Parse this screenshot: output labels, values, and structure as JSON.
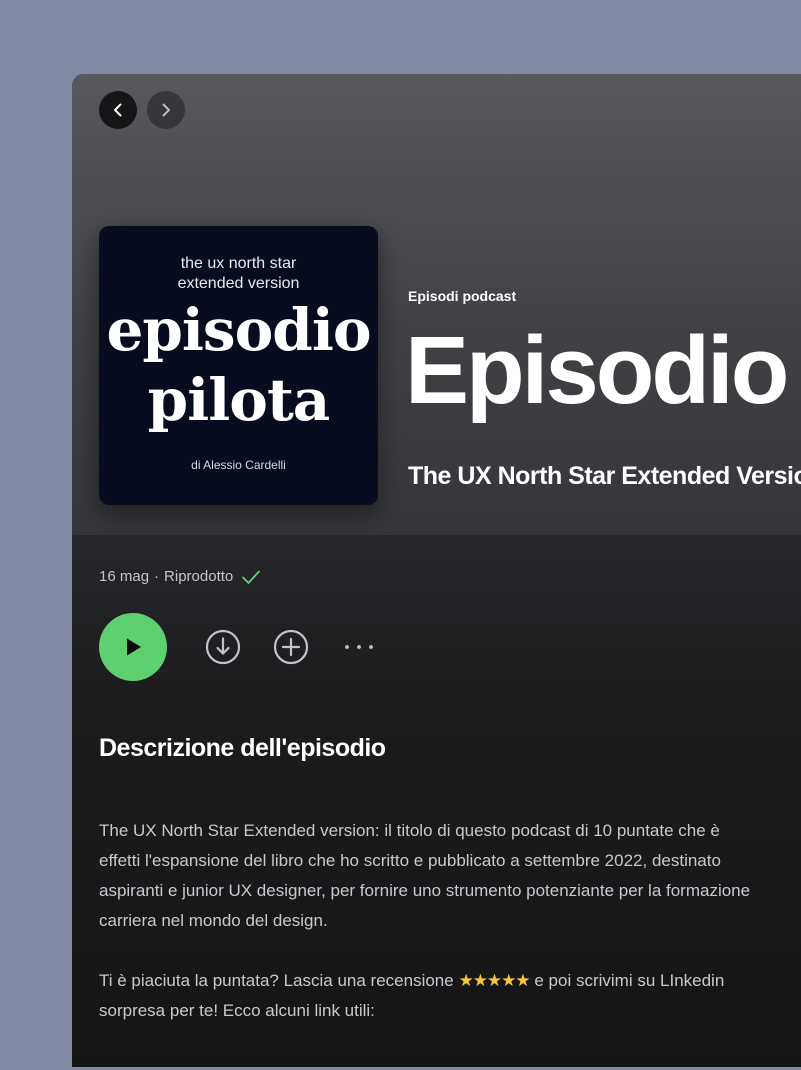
{
  "nav": {
    "back_icon": "chevron-left-icon",
    "forward_icon": "chevron-right-icon"
  },
  "cover": {
    "line1": "the ux north star",
    "line2": "extended version",
    "big1": "episodio",
    "big2": "pilota",
    "author": "di Alessio Cardelli"
  },
  "header": {
    "eyebrow": "Episodi podcast",
    "title": "Episodio pilota",
    "show_name": "The UX North Star Extended Version"
  },
  "meta": {
    "date": "16 mag",
    "separator": "·",
    "status": "Riprodotto",
    "status_icon": "checkmark-icon",
    "status_color": "#5ed06f"
  },
  "actions": {
    "play_icon": "play-icon",
    "download_icon": "download-icon",
    "add_icon": "add-icon",
    "more_icon": "more-icon",
    "accent": "#5ed06f"
  },
  "description": {
    "heading": "Descrizione dell'episodio",
    "p1_lines": [
      "The UX North Star Extended version: il titolo di questo podcast di 10 puntate che è",
      "effetti l'espansione del libro che ho scritto e pubblicato a settembre 2022, destinato",
      "aspiranti e junior UX designer, per fornire uno strumento potenziante per la formazione",
      "carriera nel mondo del design."
    ],
    "p2_line1_before": "Ti è piaciuta la puntata? Lascia una recensione ",
    "stars": "★★★★★",
    "p2_line1_after": " e poi scrivimi su LInkedin",
    "p2_line2": "sorpresa per te! Ecco alcuni link utili:"
  }
}
